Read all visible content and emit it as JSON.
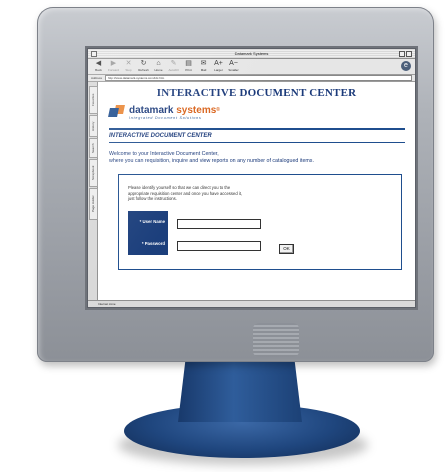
{
  "window": {
    "title": "Datamark Systems"
  },
  "toolbar": {
    "buttons": [
      {
        "label": "Back",
        "icon": "back-arrow-icon",
        "glyph": "◀"
      },
      {
        "label": "Forward",
        "icon": "forward-arrow-icon",
        "glyph": "▶"
      },
      {
        "label": "Stop",
        "icon": "stop-icon",
        "glyph": "✕"
      },
      {
        "label": "Refresh",
        "icon": "refresh-icon",
        "glyph": "↻"
      },
      {
        "label": "Home",
        "icon": "home-icon",
        "glyph": "⌂"
      },
      {
        "label": "AutoFill",
        "icon": "autofill-icon",
        "glyph": "✎"
      },
      {
        "label": "Print",
        "icon": "print-icon",
        "glyph": "▤"
      },
      {
        "label": "Mail",
        "icon": "mail-icon",
        "glyph": "✉"
      },
      {
        "label": "Larger",
        "icon": "larger-text-icon",
        "glyph": "A+"
      },
      {
        "label": "Smaller",
        "icon": "smaller-text-icon",
        "glyph": "A−"
      }
    ]
  },
  "address": {
    "label": "Address",
    "url": "http://www.datamark-systems.com/idc.htm"
  },
  "sidebar_tabs": [
    "Favorites",
    "History",
    "Search",
    "Scrapbook",
    "Page Holder"
  ],
  "page": {
    "title": "INTERACTIVE DOCUMENT CENTER",
    "brand_name_1": "datamark",
    "brand_name_2": "systems",
    "brand_mark": "®",
    "brand_tagline": "Integrated Document Solutions",
    "section_title": "INTERACTIVE DOCUMENT CENTER",
    "welcome_line1": "Welcome to your Interactive Document Center,",
    "welcome_line2": "where you can requisition, inquire and view reports on any number of catalogued items.",
    "instructions_line1": "Please identify yourself so that we can direct you to the",
    "instructions_line2": "appropriate requisition center and once you have accessed it,",
    "instructions_line3": "just follow the instructions.",
    "username_label": "* User Name",
    "password_label": "* Password",
    "ok_label": "OK"
  },
  "status": {
    "text": "Internet zone"
  },
  "colors": {
    "brand_blue": "#1b3a7a",
    "brand_orange": "#d9621a",
    "label_panel": "#1c3f7c",
    "stand_blue": "#2f5d9b"
  }
}
